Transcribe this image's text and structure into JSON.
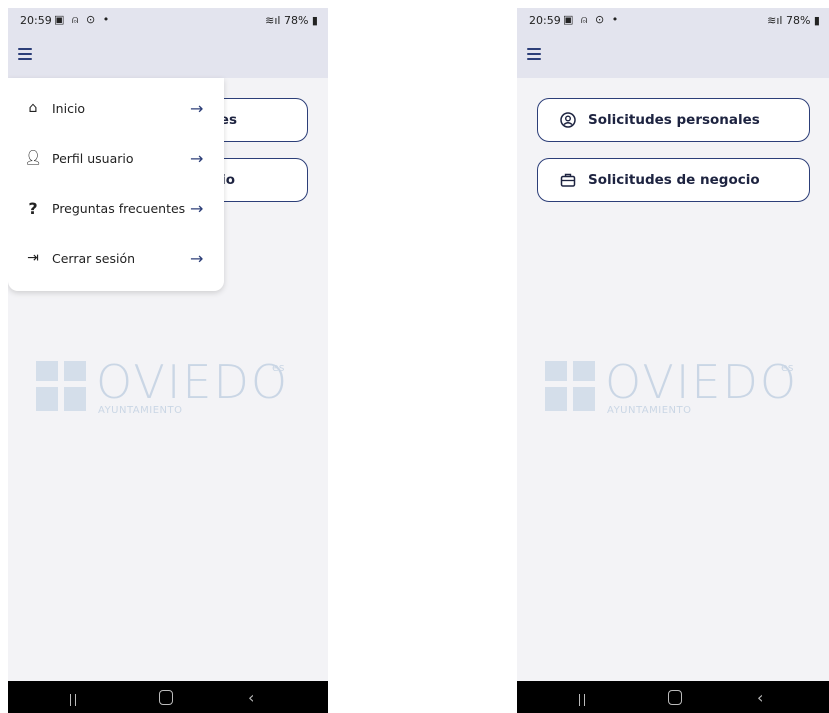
{
  "status_bar": {
    "time": "20:59",
    "icons_left": "▣ ⍝ ⊙ •",
    "signal_battery": "78%"
  },
  "drawer_menu": {
    "items": [
      {
        "label": "Inicio",
        "icon": "home-icon"
      },
      {
        "label": "Perfil usuario",
        "icon": "user-icon"
      },
      {
        "label": "Preguntas frecuentes",
        "icon": "question-icon"
      },
      {
        "label": "Cerrar sesión",
        "icon": "logout-icon"
      }
    ]
  },
  "home": {
    "buttons": [
      {
        "label": "Solicitudes personales",
        "icon": "user-circle-icon"
      },
      {
        "label": "Solicitudes de negocio",
        "icon": "briefcase-icon"
      }
    ],
    "partial_labels": [
      "es",
      "io"
    ]
  },
  "logo": {
    "name": "OVIEDO",
    "suffix": "es",
    "subtitle": "AYUNTAMIENTO"
  },
  "colors": {
    "accent": "#2c3e78",
    "appbar": "#e3e4ee",
    "background": "#f3f3f6"
  }
}
